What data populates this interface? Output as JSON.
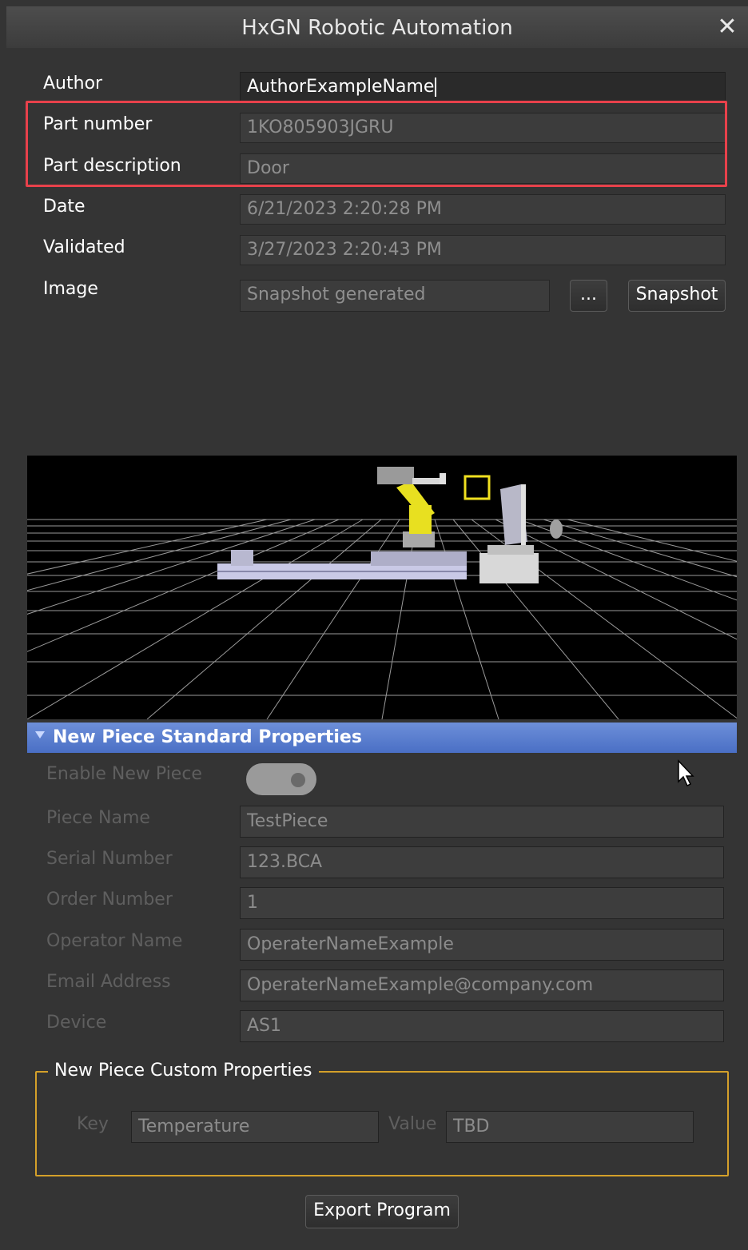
{
  "window": {
    "title": "HxGN Robotic Automation"
  },
  "form": {
    "author": {
      "label": "Author",
      "value": "AuthorExampleName"
    },
    "part_number": {
      "label": "Part number",
      "value": "1KO805903JGRU"
    },
    "part_description": {
      "label": "Part description",
      "value": "Door"
    },
    "date": {
      "label": "Date",
      "value": "6/21/2023 2:20:28 PM"
    },
    "validated": {
      "label": "Validated",
      "value": "3/27/2023 2:20:43 PM"
    },
    "image": {
      "label": "Image",
      "value": "Snapshot generated",
      "browse_label": "...",
      "snapshot_label": "Snapshot"
    }
  },
  "standard": {
    "title": "New Piece Standard Properties",
    "enable_label": "Enable New Piece",
    "fields": [
      {
        "label": "Piece Name",
        "value": "TestPiece"
      },
      {
        "label": "Serial Number",
        "value": "123.BCA"
      },
      {
        "label": "Order Number",
        "value": "1"
      },
      {
        "label": "Operator Name",
        "value": "OperaterNameExample"
      },
      {
        "label": "Email Address",
        "value": "OperaterNameExample@company.com"
      },
      {
        "label": "Device",
        "value": "AS1"
      }
    ]
  },
  "custom": {
    "title": "New Piece Custom Properties",
    "key_label": "Key",
    "key_value": "Temperature",
    "value_label": "Value",
    "value_value": "TBD"
  },
  "actions": {
    "export_label": "Export Program"
  },
  "colors": {
    "highlight": "#e8414b",
    "section_header": "#5a7fd0",
    "groupbox_border": "#d4a02a"
  }
}
